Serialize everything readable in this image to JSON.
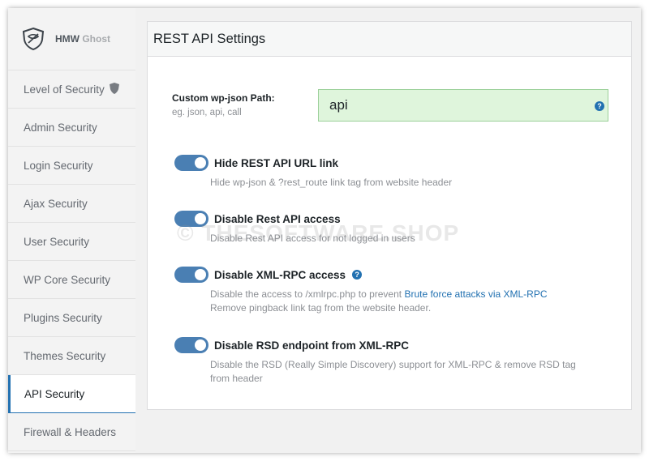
{
  "brand": {
    "name": "HMW",
    "name_light": "Ghost"
  },
  "sidebar": {
    "items": [
      {
        "label": "Level of Security"
      },
      {
        "label": "Admin Security"
      },
      {
        "label": "Login Security"
      },
      {
        "label": "Ajax Security"
      },
      {
        "label": "User Security"
      },
      {
        "label": "WP Core Security"
      },
      {
        "label": "Plugins Security"
      },
      {
        "label": "Themes Security"
      },
      {
        "label": "API Security"
      },
      {
        "label": "Firewall & Headers"
      }
    ],
    "active_index": 8
  },
  "panel": {
    "title": "REST API Settings",
    "path_field": {
      "label": "Custom wp-json Path:",
      "hint": "eg. json, api, call",
      "value": "api"
    },
    "options": [
      {
        "title": "Hide REST API URL link",
        "desc": "Hide wp-json & ?rest_route link tag from website header",
        "enabled": true
      },
      {
        "title": "Disable Rest API access",
        "desc": "Disable Rest API access for not logged in users",
        "enabled": true
      },
      {
        "title": "Disable XML-RPC access",
        "desc_pre": "Disable the access to /xmlrpc.php to prevent ",
        "desc_link": "Brute force attacks via XML-RPC",
        "desc2": "Remove pingback link tag from the website header.",
        "enabled": true
      },
      {
        "title": "Disable RSD endpoint from XML-RPC",
        "desc": "Disable the RSD (Really Simple Discovery) support for XML-RPC & remove RSD tag from header",
        "enabled": true
      }
    ]
  },
  "watermark": "© THESOFTWARE.SHOP",
  "colors": {
    "accent": "#2271b1",
    "toggle_on": "#4a7fb3",
    "input_bg": "#dff5dc"
  }
}
